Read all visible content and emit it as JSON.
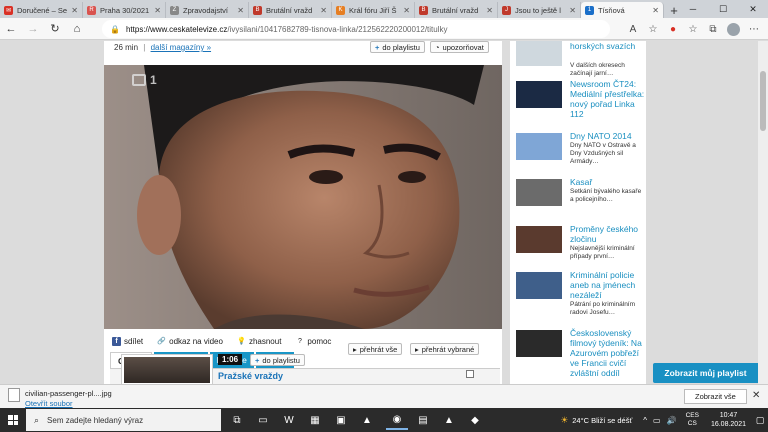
{
  "tabs": [
    {
      "title": "Doručené – Se",
      "fav_color": "#d93025",
      "fav": "✉",
      "active": false
    },
    {
      "title": "Praha 30/2021",
      "fav_color": "#d9534f",
      "fav": "R",
      "active": false
    },
    {
      "title": "Zpravodajství",
      "fav_color": "#888888",
      "fav": "Z",
      "active": false
    },
    {
      "title": "Brutální vražd",
      "fav_color": "#c0392b",
      "fav": "B",
      "active": false
    },
    {
      "title": "Král fóru Jiří Š",
      "fav_color": "#e67e22",
      "fav": "K",
      "active": false
    },
    {
      "title": "Brutální vražd",
      "fav_color": "#c0392b",
      "fav": "B",
      "active": false
    },
    {
      "title": "Jsou to ještě l",
      "fav_color": "#c0392b",
      "fav": "J",
      "active": false
    },
    {
      "title": "Tísňová",
      "fav_color": "#1a6fc9",
      "fav": "1",
      "active": true
    }
  ],
  "url": {
    "host": "https://www.ceskatelevize.cz",
    "path": "/ivysilani/10417682789-tisnova-linka/212562220200012/titulky"
  },
  "meta": {
    "duration": "26 min",
    "sep": "|",
    "more_link": "další magazíny »"
  },
  "buttons": {
    "playlist": "do playlistu",
    "notify": "upozorňovat"
  },
  "share": {
    "share": "sdílet",
    "link": "odkaz na video",
    "dim": "zhasnout",
    "help": "pomoc"
  },
  "content_tabs": [
    {
      "label": "Obsah",
      "active": true
    },
    {
      "label": "Další části",
      "active": false
    },
    {
      "label": "Diskuse",
      "active": false
    },
    {
      "label": "Titulky",
      "active": false
    }
  ],
  "episode": {
    "duration": "1:06",
    "playlist": "do playlistu",
    "play_all": "přehrát vše",
    "play_selected": "přehrát vybrané",
    "title": "Pražské vraždy"
  },
  "side_items": [
    {
      "title": "horských svazích",
      "desc": "V dalších okresech začínají jarní…",
      "thumb": "#cfd8de"
    },
    {
      "title": "Newsroom ČT24: Mediální přestřelka: nový pořad Linka 112",
      "desc": "",
      "thumb": "#1b2a44"
    },
    {
      "title": "Dny NATO 2014",
      "desc": "Dny NATO v Ostravě a Dny Vzdušných sil Armády…",
      "thumb": "#7fa6d6"
    },
    {
      "title": "Kasař",
      "desc": "Setkání bývalého kasaře a policejního…",
      "thumb": "#6b6b6b"
    },
    {
      "title": "Proměny českého zločinu",
      "desc": "Nejslavnější kriminální případy první…",
      "thumb": "#5a3a2e"
    },
    {
      "title": "Kriminální policie aneb na jménech nezáleží",
      "desc": "Pátrání po kriminálním radovi Josefu…",
      "thumb": "#3f5f8a"
    },
    {
      "title": "Československý filmový týdeník: Na Azurovém pobřeží ve Francii cvičí zvláštní oddíl",
      "desc": "",
      "thumb": "#2a2a2a"
    }
  ],
  "playlist_button": "Zobrazit můj playlist",
  "download": {
    "filename": "civilian-passenger-pl....jpg",
    "open": "Otevřít soubor",
    "show_all": "Zobrazit vše"
  },
  "taskbar": {
    "search": "Sem zadejte hledaný výraz",
    "weather": "24°C  Bliží se déšť",
    "lang1": "CES",
    "lang2": "CS",
    "time": "10:47",
    "date": "16.08.2021"
  }
}
